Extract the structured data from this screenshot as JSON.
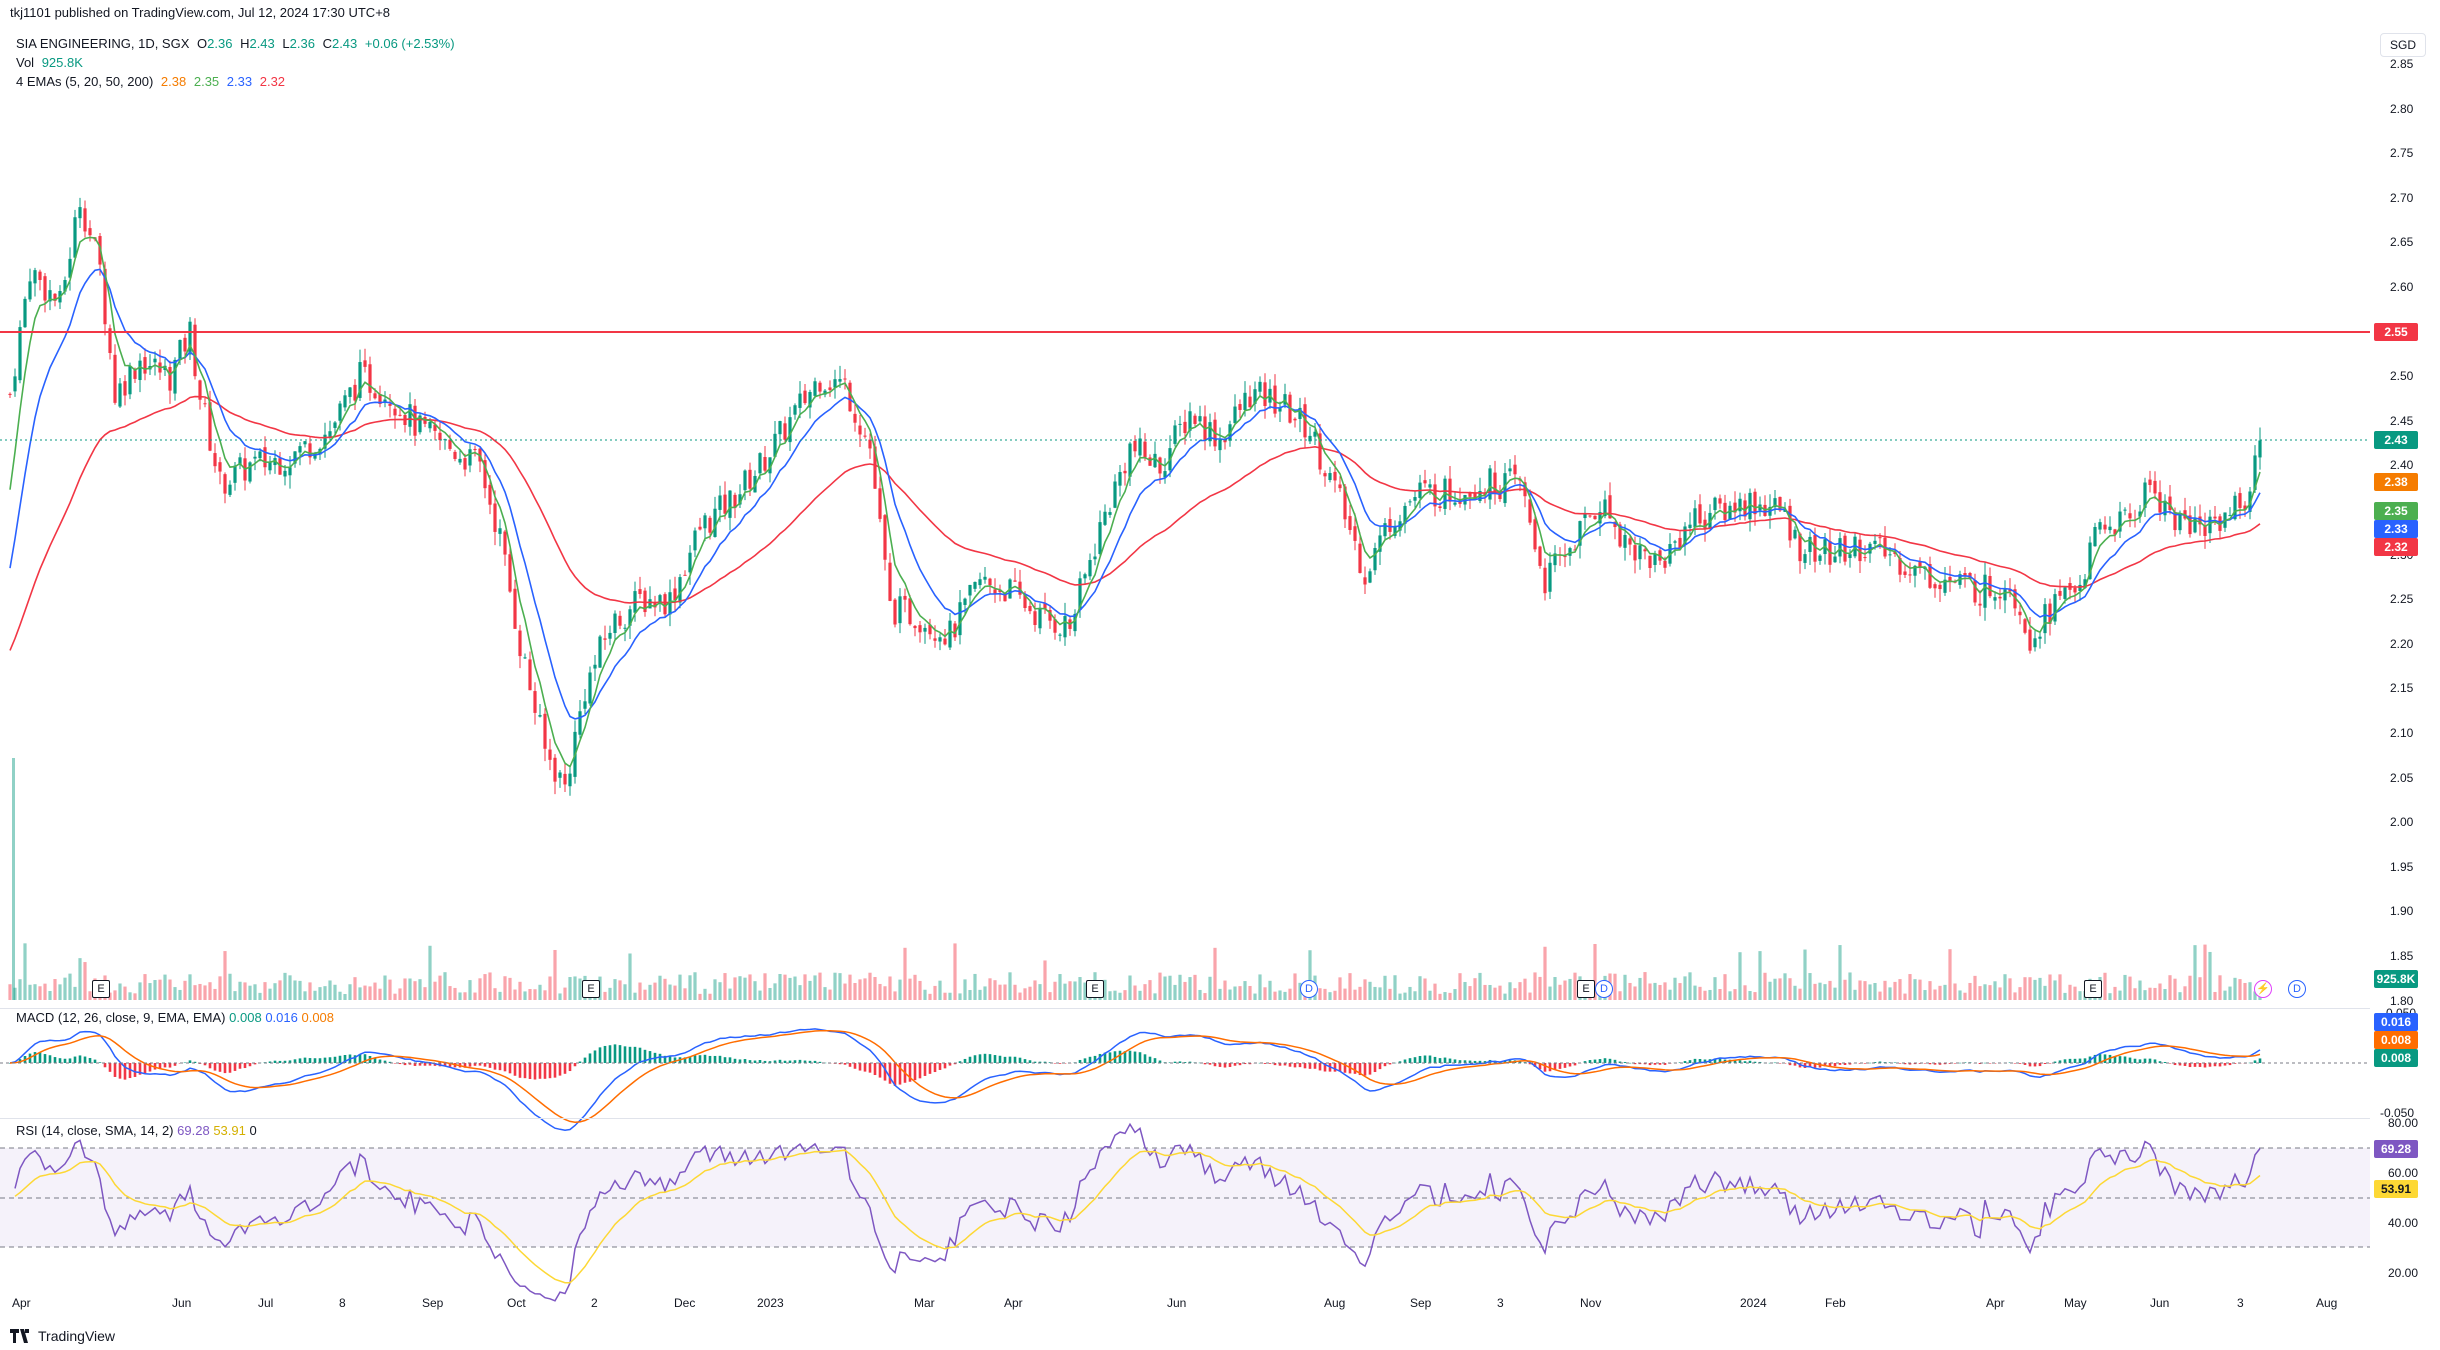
{
  "publish_line": "tkj1101 published on TradingView.com, Jul 12, 2024 17:30 UTC+8",
  "legend": {
    "symbol": "SIA ENGINEERING, 1D, SGX",
    "o_label": "O",
    "o": "2.36",
    "h_label": "H",
    "h": "2.43",
    "l_label": "L",
    "l": "2.36",
    "c_label": "C",
    "c": "2.43",
    "change": "+0.06 (+2.53%)",
    "vol_label": "Vol",
    "vol": "925.8K",
    "ema_label": "4 EMAs (5, 20, 50, 200)",
    "ema5": "2.38",
    "ema20": "2.35",
    "ema50": "2.33",
    "ema200": "2.32"
  },
  "currency": "SGD",
  "price_axis": [
    "2.85",
    "2.80",
    "2.75",
    "2.70",
    "2.65",
    "2.60",
    "2.55",
    "2.50",
    "2.45",
    "2.40",
    "2.35",
    "2.30",
    "2.25",
    "2.20",
    "2.15",
    "2.10",
    "2.05",
    "2.00",
    "1.95",
    "1.90",
    "1.85",
    "1.80"
  ],
  "price_tags": {
    "resistance": "2.55",
    "last": "2.43",
    "ema5": "2.38",
    "ema20": "2.35",
    "ema50": "2.33",
    "ema200": "2.32",
    "volume": "925.8K"
  },
  "macd": {
    "label": "MACD (12, 26, close, 9, EMA, EMA)",
    "hist": "0.008",
    "macd": "0.016",
    "signal": "0.008",
    "axis": [
      "0.050",
      "0.000",
      "-0.050"
    ],
    "tags": [
      "0.016",
      "0.008",
      "0.008"
    ]
  },
  "rsi": {
    "label": "RSI (14, close, SMA, 14, 2)",
    "rsi": "69.28",
    "sma": "53.91",
    "extra": "0",
    "axis": [
      "80.00",
      "60.00",
      "40.00",
      "20.00"
    ],
    "tags": [
      "69.28",
      "53.91"
    ]
  },
  "time_axis": [
    "Apr",
    "Jun",
    "Jul",
    "8",
    "Sep",
    "Oct",
    "2",
    "Dec",
    "2023",
    "Mar",
    "Apr",
    "Jun",
    "Aug",
    "Sep",
    "3",
    "Nov",
    "2024",
    "Feb",
    "Apr",
    "May",
    "Jun",
    "3",
    "Aug"
  ],
  "events": {
    "e": "E",
    "d": "D",
    "s": "⚡"
  },
  "logo_text": "TradingView",
  "colors": {
    "up": "#089981",
    "down": "#f23645",
    "ema5": "#f57c00",
    "ema20": "#4caf50",
    "ema50": "#2962ff",
    "ema200": "#f23645",
    "macd": "#2962ff",
    "signal": "#ff6d00",
    "rsi": "#7e57c2",
    "rsi_ma": "#fdd835"
  }
}
